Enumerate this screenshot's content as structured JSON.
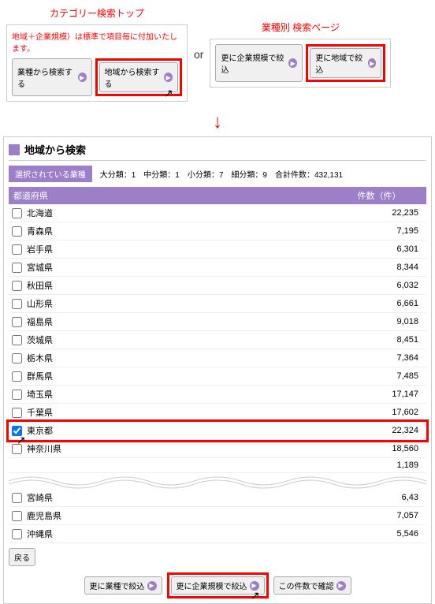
{
  "top": {
    "left_title": "カテゴリー検索トップ",
    "right_title": "業種別 検索ページ",
    "note": "地域＋企業規模）は標準で項目毎に付加いたします。",
    "btn_industry": "業種から検索する",
    "btn_region": "地域から検索する",
    "btn_more_size": "更に企業規模で絞込",
    "btn_more_region": "更に地域で絞込",
    "or": "or"
  },
  "main": {
    "title": "地域から検索",
    "selected_label": "選択されている業種",
    "counts": {
      "dai": "大分類：1",
      "chu": "中分類：1",
      "sho": "小分類：7",
      "sai": "細分類：9",
      "total": "合計件数：432,131"
    },
    "th_name": "都道府県",
    "th_count": "件数（件）",
    "rows": [
      {
        "name": "北海道",
        "count": "22,235",
        "checked": false
      },
      {
        "name": "青森県",
        "count": "7,195",
        "checked": false
      },
      {
        "name": "岩手県",
        "count": "6,301",
        "checked": false
      },
      {
        "name": "宮城県",
        "count": "8,344",
        "checked": false
      },
      {
        "name": "秋田県",
        "count": "6,032",
        "checked": false
      },
      {
        "name": "山形県",
        "count": "6,661",
        "checked": false
      },
      {
        "name": "福島県",
        "count": "9,018",
        "checked": false
      },
      {
        "name": "茨城県",
        "count": "8,451",
        "checked": false
      },
      {
        "name": "栃木県",
        "count": "7,364",
        "checked": false
      },
      {
        "name": "群馬県",
        "count": "7,485",
        "checked": false
      },
      {
        "name": "埼玉県",
        "count": "17,147",
        "checked": false
      },
      {
        "name": "千葉県",
        "count": "17,602",
        "checked": false
      },
      {
        "name": "東京都",
        "count": "22,324",
        "checked": true,
        "highlight": true
      },
      {
        "name": "神奈川県",
        "count": "18,560",
        "checked": false
      }
    ],
    "partial_count": "1,189",
    "rows_after": [
      {
        "name": "宮崎県",
        "count": "6,43 ",
        "checked": false
      },
      {
        "name": "鹿児島県",
        "count": "7,057",
        "checked": false
      },
      {
        "name": "沖縄県",
        "count": "5,546",
        "checked": false
      }
    ],
    "back": "戻る",
    "btn_industry_narrow": "更に業種で絞込",
    "btn_size_narrow": "更に企業規模で絞込",
    "btn_confirm": "この件数で確認"
  }
}
